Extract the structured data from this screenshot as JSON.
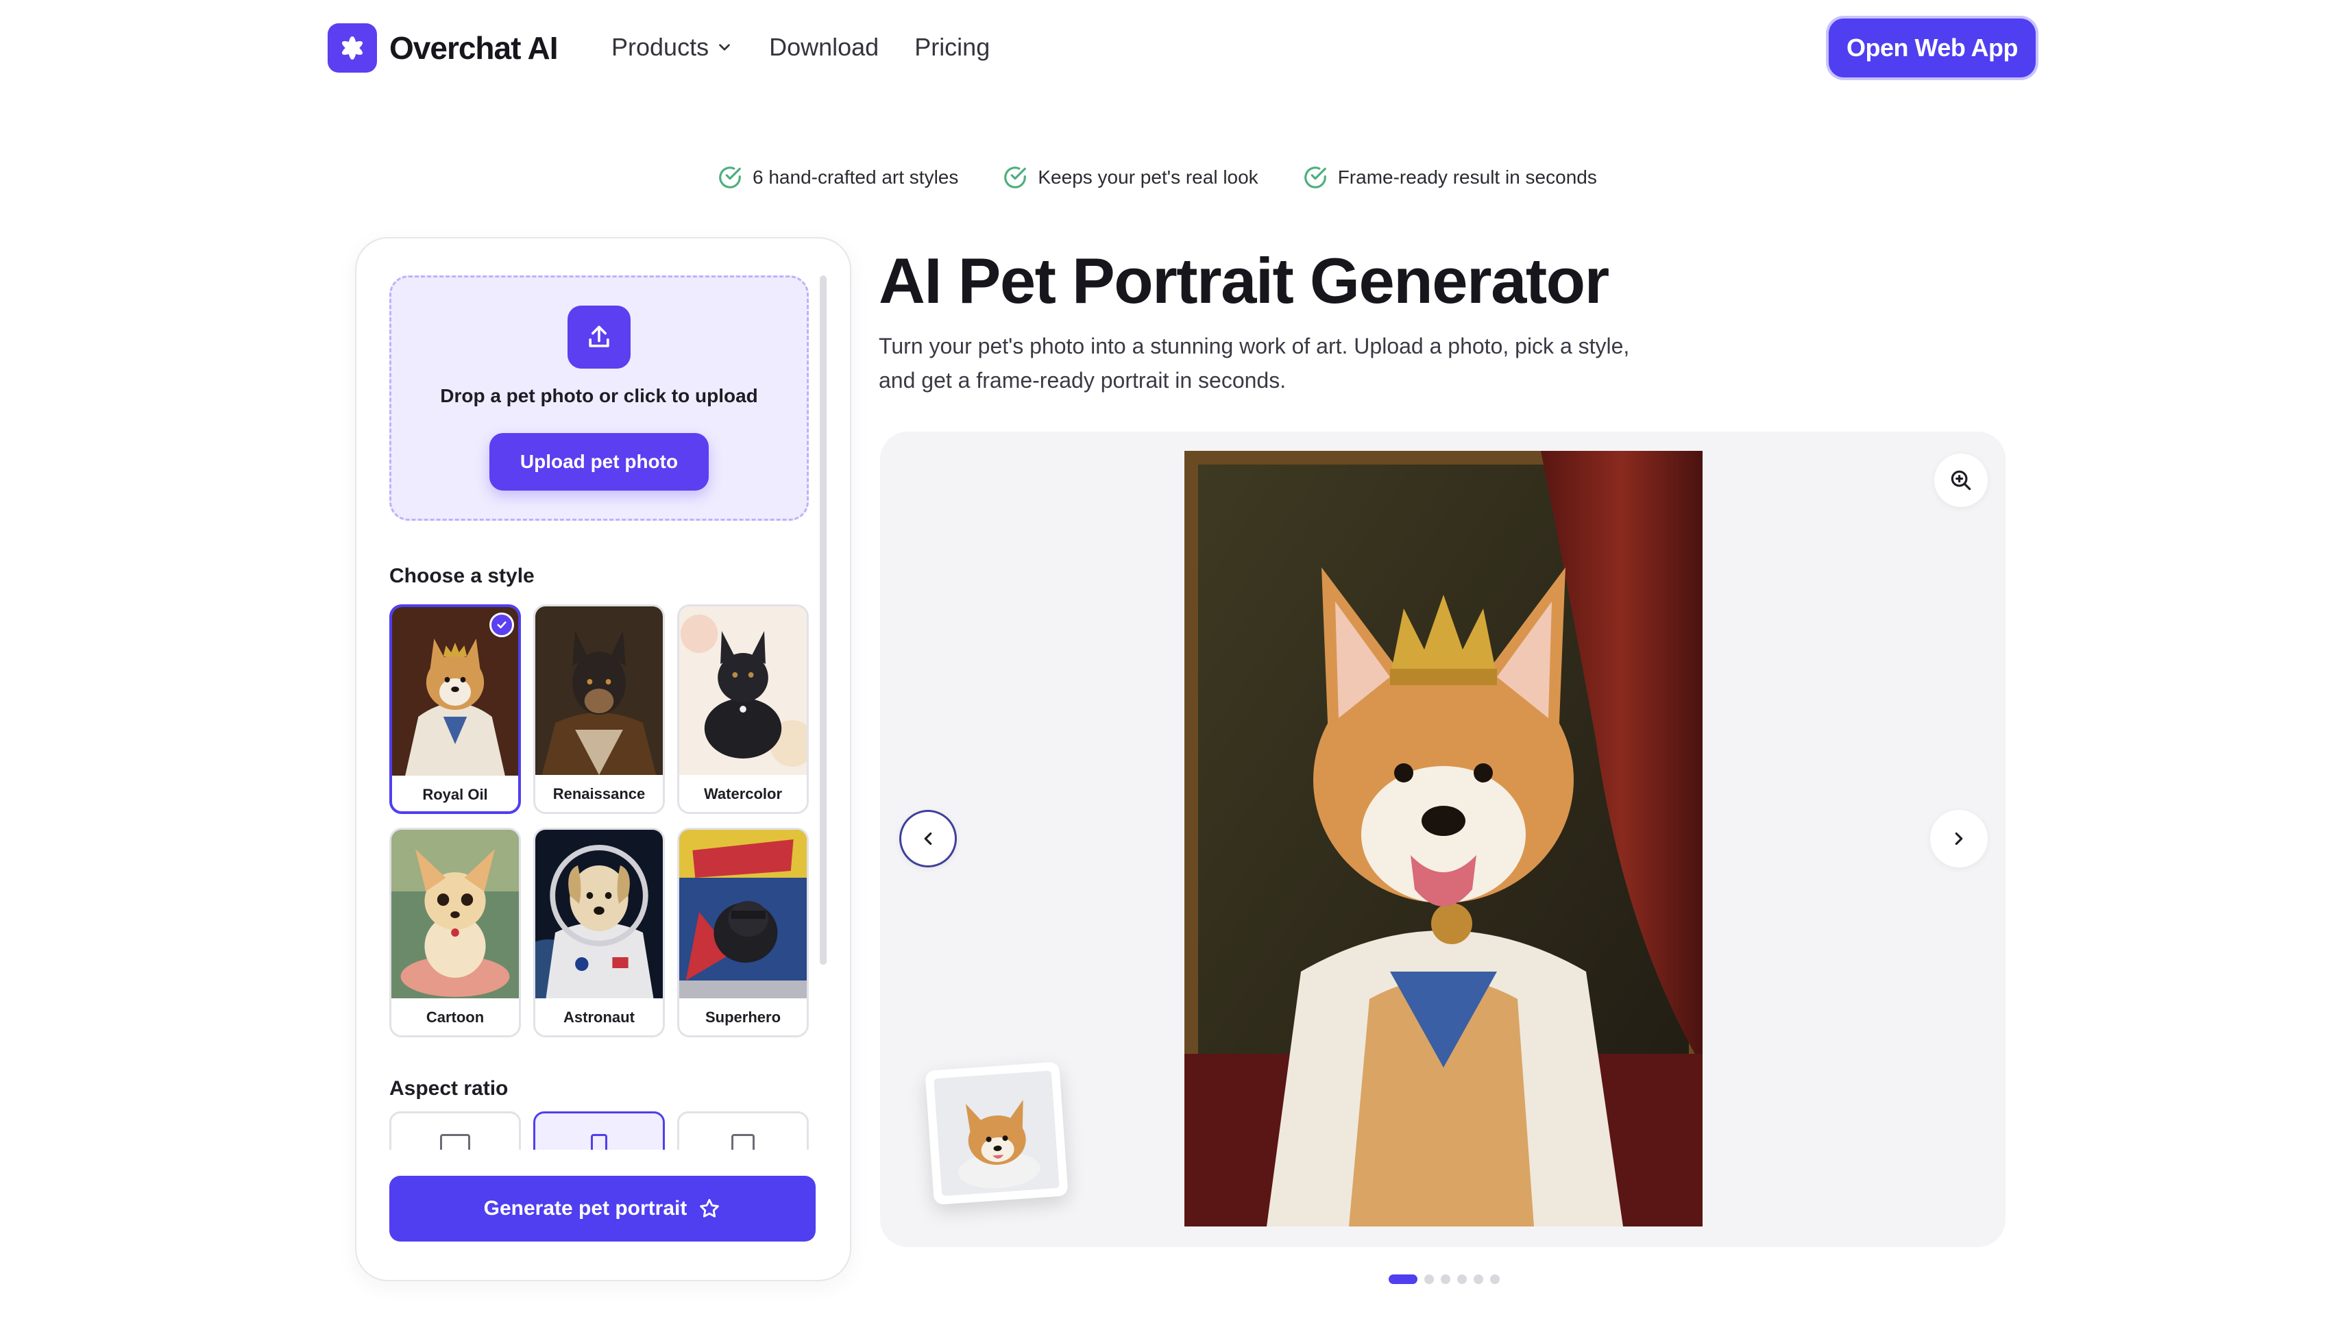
{
  "brand": {
    "name": "Overchat AI",
    "accent": "#4f3ff0"
  },
  "nav": {
    "links": [
      "Products",
      "Download",
      "Pricing"
    ],
    "cta": "Open Web App"
  },
  "features": [
    "6 hand-crafted art styles",
    "Keeps your pet's real look",
    "Frame-ready result in seconds"
  ],
  "upload": {
    "prompt": "Drop a pet photo or click to upload",
    "button": "Upload pet photo"
  },
  "styles": {
    "title": "Choose a style",
    "items": [
      "Royal Oil",
      "Renaissance",
      "Watercolor",
      "Cartoon",
      "Astronaut",
      "Superhero"
    ],
    "selected": "Royal Oil"
  },
  "aspect": {
    "title": "Aspect ratio",
    "options": [
      "landscape",
      "portrait",
      "square"
    ],
    "selected": "portrait"
  },
  "generate": {
    "label": "Generate pet portrait"
  },
  "hero": {
    "title": "AI Pet Portrait Generator",
    "description": "Turn your pet's photo into a stunning work of art. Upload a photo, pick a style, and get a frame-ready portrait in seconds."
  },
  "carousel": {
    "slides": 6,
    "active": 1
  },
  "icons": {
    "logo": "asterisk-flower-icon",
    "dropdown": "chevron-down-icon",
    "feature": "check-circle-icon",
    "upload": "upload-icon",
    "selected": "check-icon",
    "generate": "star-icon",
    "zoom": "zoom-in-icon",
    "prev": "chevron-left-icon",
    "next": "chevron-right-icon"
  }
}
